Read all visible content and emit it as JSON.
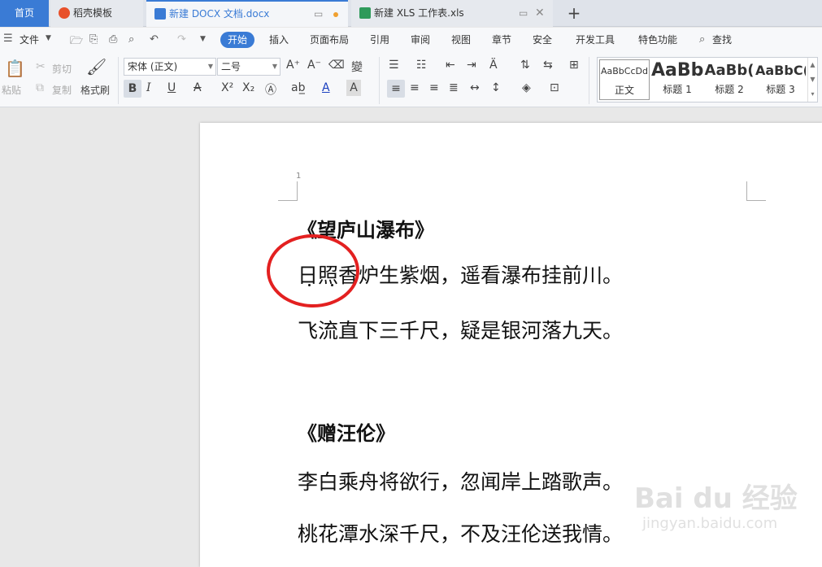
{
  "tabs": {
    "home": "首页",
    "templates": "稻壳模板",
    "docx": "新建 DOCX 文档.docx",
    "xls": "新建 XLS 工作表.xls",
    "new_tab": "+"
  },
  "menu": {
    "file": "文件",
    "items": [
      "开始",
      "插入",
      "页面布局",
      "引用",
      "审阅",
      "视图",
      "章节",
      "安全",
      "开发工具",
      "特色功能",
      "查找"
    ]
  },
  "ribbon": {
    "paste": "粘贴",
    "cut": "剪切",
    "copy": "复制",
    "format_painter": "格式刷",
    "font_name": "宋体 (正文)",
    "font_size": "二号",
    "bold": "B",
    "italic": "I",
    "underline": "U",
    "styles": [
      {
        "preview": "AaBbCcDd",
        "label": "正文"
      },
      {
        "preview": "AaBb",
        "label": "标题 1"
      },
      {
        "preview": "AaBb(",
        "label": "标题 2"
      },
      {
        "preview": "AaBbC(",
        "label": "标题 3"
      }
    ]
  },
  "document": {
    "page_number": "1",
    "lines": [
      "《望庐山瀑布》",
      "日照香炉生紫烟，遥看瀑布挂前川。",
      "飞流直下三千尺，疑是银河落九天。",
      "《赠汪伦》",
      "李白乘舟将欲行，忽闻岸上踏歌声。",
      "桃花潭水深千尺，不及汪伦送我情。"
    ]
  },
  "watermark": {
    "main": "Bai du 经验",
    "sub": "jingyan.baidu.com"
  },
  "colors": {
    "accent": "#3a7bd5",
    "annotation": "#e32020"
  }
}
